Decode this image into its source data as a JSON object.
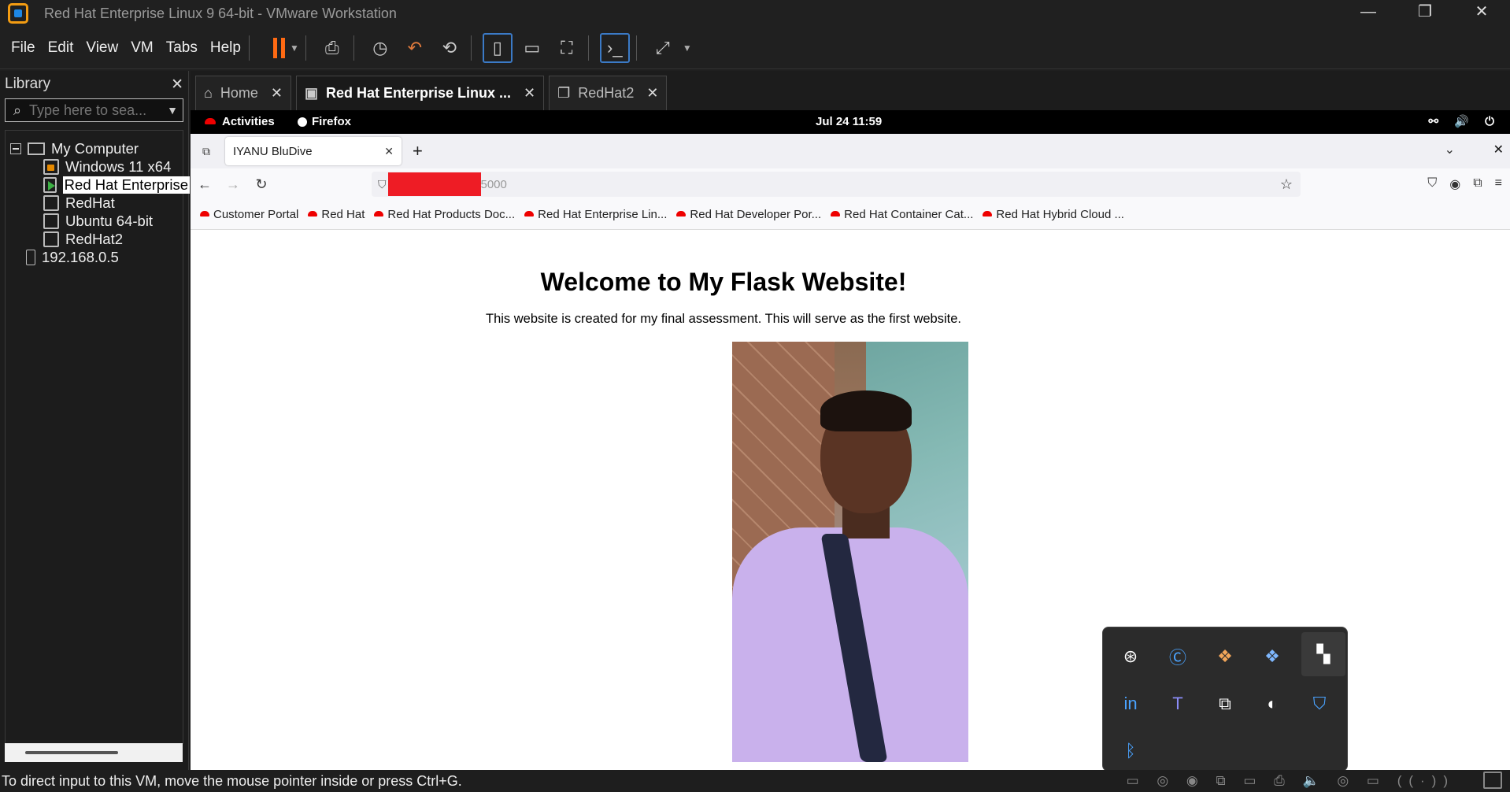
{
  "window": {
    "title": "Red Hat Enterprise Linux 9 64-bit - VMware Workstation",
    "controls": {
      "minimize": "—",
      "maximize": "❐",
      "close": "✕"
    }
  },
  "menu": {
    "items": [
      "File",
      "Edit",
      "View",
      "VM",
      "Tabs",
      "Help"
    ]
  },
  "library": {
    "title": "Library",
    "close": "✕",
    "search_placeholder": "Type here to sea...",
    "tree": {
      "root": "My Computer",
      "vms": [
        "Windows 11 x64",
        "Red Hat Enterprise",
        "RedHat",
        "Ubuntu 64-bit",
        "RedHat2"
      ],
      "remote": "192.168.0.5"
    }
  },
  "vm_tabs": [
    {
      "label": "Home",
      "close": "✕"
    },
    {
      "label": "Red Hat Enterprise Linux ...",
      "close": "✕"
    },
    {
      "label": "RedHat2",
      "close": "✕"
    }
  ],
  "gnome": {
    "activities": "Activities",
    "app": "Firefox",
    "clock": "Jul 24  11:59"
  },
  "firefox": {
    "tab_title": "IYANU BluDive",
    "tab_close": "✕",
    "new_tab": "+",
    "url_visible": "5000",
    "bookmarks": [
      "Customer Portal",
      "Red Hat",
      "Red Hat Products Doc...",
      "Red Hat Enterprise Lin...",
      "Red Hat Developer Por...",
      "Red Hat Container Cat...",
      "Red Hat Hybrid Cloud ..."
    ]
  },
  "page": {
    "heading": "Welcome to My Flask Website!",
    "paragraph": "This website is created for my final assessment. This will serve as the first website."
  },
  "statusbar": {
    "message": "To direct input to this VM, move the mouse pointer inside or press Ctrl+G."
  },
  "colors": {
    "accent_orange": "#ff6a13",
    "redacted": "#ee1c25",
    "redhat_red": "#ee0000"
  }
}
